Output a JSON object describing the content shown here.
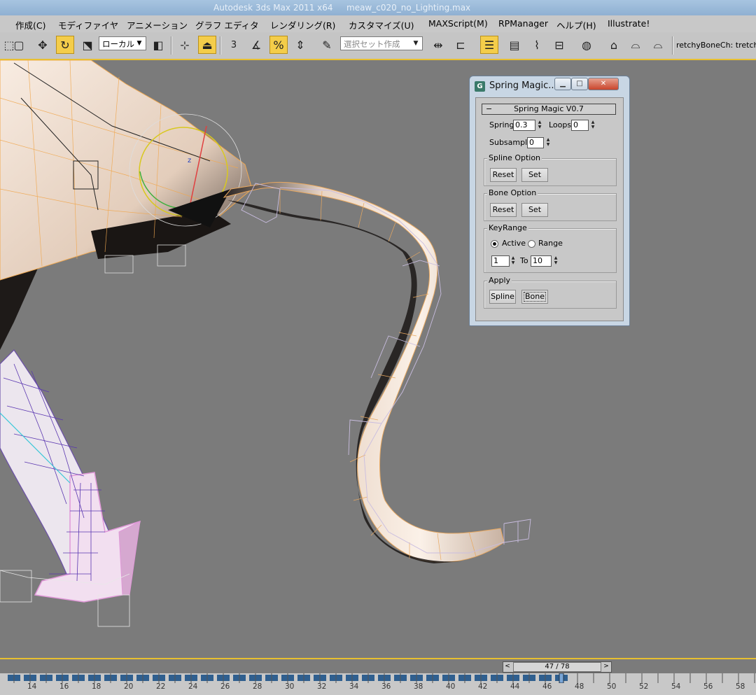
{
  "window": {
    "app_title": "Autodesk 3ds Max  2011 x64",
    "file_title": "meaw_c020_no_Lighting.max"
  },
  "menu": [
    "作成(C)",
    "モディファイヤ",
    "アニメーション",
    "グラフ エディタ",
    "レンダリング(R)",
    "カスタマイズ(U)",
    "MAXScript(M)",
    "RPManager",
    "ヘルプ(H)",
    "Illustrate!"
  ],
  "toolbar": {
    "ref_coord": "ローカル",
    "named_selection_placeholder": "選択セット作成",
    "snap_label": "3",
    "tools_text": "retchyBoneCh: tretchyI",
    "icons": [
      "select-region-icon",
      "move-icon",
      "rotate-icon",
      "scale-icon",
      "pivot-icon",
      "manipulate-icon",
      "snap-icon",
      "angle-snap-icon",
      "percent-snap-icon",
      "spinner-snap-icon",
      "edit-named-sel-icon",
      "mirror-icon",
      "align-icon",
      "layer-icon",
      "curve-editor-icon",
      "schematic-icon",
      "material-editor-icon",
      "render-setup-icon",
      "render-frame-icon",
      "render-icon"
    ]
  },
  "dialog": {
    "title": "Spring Magic...",
    "rollout": "Spring Magic V0.7",
    "spring_label": "Spring",
    "spring_value": "0.3",
    "loops_label": "Loops",
    "loops_value": "0",
    "subsample_label": "Subsample",
    "subsample_value": "0",
    "spline_group": "Spline Option",
    "bone_group": "Bone Option",
    "reset": "Reset",
    "set": "Set",
    "keyrange_group": "KeyRange",
    "active": "Active",
    "range": "Range",
    "range_from": "1",
    "to_label": "To",
    "range_to": "10",
    "apply_group": "Apply",
    "apply_spline": "Spline",
    "apply_bone": "Bone",
    "minimize": "▁",
    "maximize": "□",
    "close": "✕"
  },
  "timeline": {
    "frame_display": "47 / 78",
    "current_frame": 47,
    "total_frames": 78,
    "prev": "<",
    "next": ">",
    "ticks": [
      "14",
      "16",
      "18",
      "20",
      "22",
      "24",
      "26",
      "28",
      "30",
      "32",
      "34",
      "36",
      "38",
      "40",
      "42",
      "44",
      "46",
      "48",
      "50",
      "52",
      "54",
      "56",
      "58"
    ]
  },
  "colors": {
    "accent": "#e8c030",
    "viewport_bg": "#7b7b7b",
    "toolbar_bg": "#c5c5c5",
    "mesh_fill": "#efe0d2",
    "mesh_wire": "#e8a860",
    "bone_wire": "#c9bde0"
  }
}
